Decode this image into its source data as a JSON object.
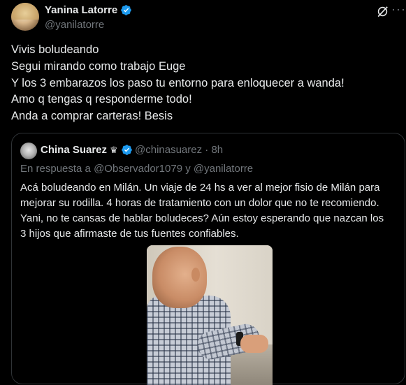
{
  "author": {
    "name": "Yanina Latorre",
    "handle": "@yanilatorre",
    "verified_color": "#1d9bf0"
  },
  "body_lines": [
    "Vivis boludeando",
    "Segui mirando como trabajo Euge",
    "Y los 3 embarazos los paso tu entorno para enloquecer a wanda!",
    "Amo q tengas q responderme todo!",
    "Anda a comprar carteras! Besis"
  ],
  "quote": {
    "name": "China Suarez",
    "crown_glyph": "♛",
    "handle": "@chinasuarez",
    "separator": "·",
    "time": "8h",
    "reply_prefix": "En respuesta a",
    "reply_mention_1": "@Observador1079",
    "reply_and": "y",
    "reply_mention_2": "@yanilatorre",
    "text_lines": [
      "Acá boludeando en Milán. Un viaje de 24 hs a ver al mejor fisio de Milán para",
      "mejorar su rodilla. 4 horas de tratamiento con un dolor que no te recomiendo.",
      "Yani, no te cansas de hablar boludeces? Aún estoy esperando que nazcan los",
      "3 hijos que afirmaste de tus fuentes confiables."
    ]
  },
  "icons": {
    "grok": "grok-icon",
    "more": "more-options-icon",
    "verified": "verified-badge-icon"
  },
  "colors": {
    "background": "#000000",
    "text": "#e7e9ea",
    "secondary_text": "#71767b",
    "border": "#2f3336",
    "accent": "#1d9bf0"
  }
}
